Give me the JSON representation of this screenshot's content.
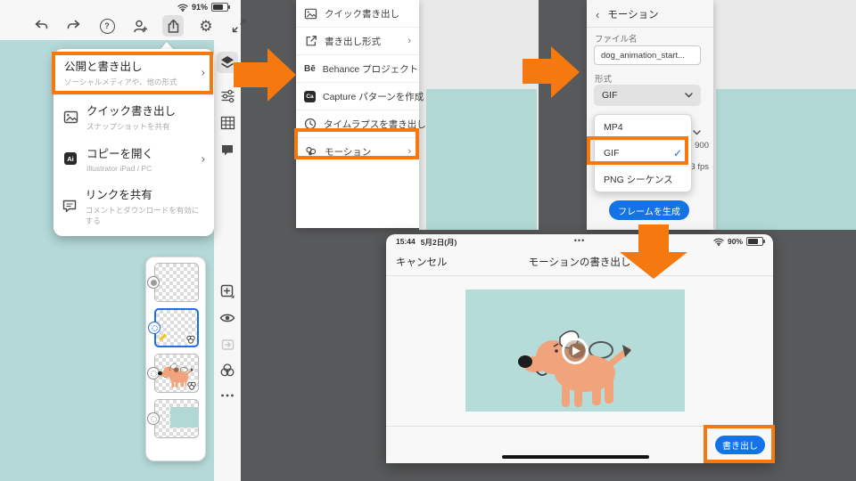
{
  "colors": {
    "accent_orange": "#F5790F",
    "accent_blue": "#1473E6",
    "canvas_teal": "#B5D9D8",
    "dark_background": "#58595A"
  },
  "glyphs": {
    "check": "✓",
    "chevron_right": "›",
    "chevron_left": "‹",
    "help": "?",
    "gear": "⚙"
  },
  "screen1": {
    "statusbar": {
      "battery_pct": "91%"
    },
    "menu": {
      "item0": {
        "label": "公開と書き出し",
        "sublabel": "ソーシャルメディアや、他の形式"
      },
      "item1": {
        "label": "クイック書き出し",
        "sublabel": "スナップショットを共有"
      },
      "item2": {
        "label": "コピーを開く",
        "sublabel": "Illustrator iPad / PC",
        "badge": "Ai"
      },
      "item3": {
        "label": "リンクを共有",
        "sublabel": "コメントとダウンロードを有効にする"
      }
    }
  },
  "menu2": {
    "item0": "クイック書き出し",
    "item1": "書き出し形式",
    "item2": "Behance プロジェクト",
    "item2_badge": "Bē",
    "item3": "Capture パターンを作成",
    "item3_badge": "Ca",
    "item4": "タイムラプスを書き出し",
    "item5": "モーション"
  },
  "panel3": {
    "title": "モーション",
    "filename_label": "ファイル名",
    "filename_value": "dog_animation_start...",
    "format_label": "形式",
    "format_value": "GIF",
    "option0": "MP4",
    "option1": "GIF",
    "option2": "PNG シーケンス",
    "partial_dimension": "900",
    "partial_fps": "3 fps",
    "generate_button": "フレームを生成"
  },
  "modal": {
    "time": "15:44",
    "date": "5月2日(月)",
    "menu_dots": "•••",
    "battery_pct": "90%",
    "cancel": "キャンセル",
    "title": "モーションの書き出し",
    "export_button": "書き出し"
  }
}
